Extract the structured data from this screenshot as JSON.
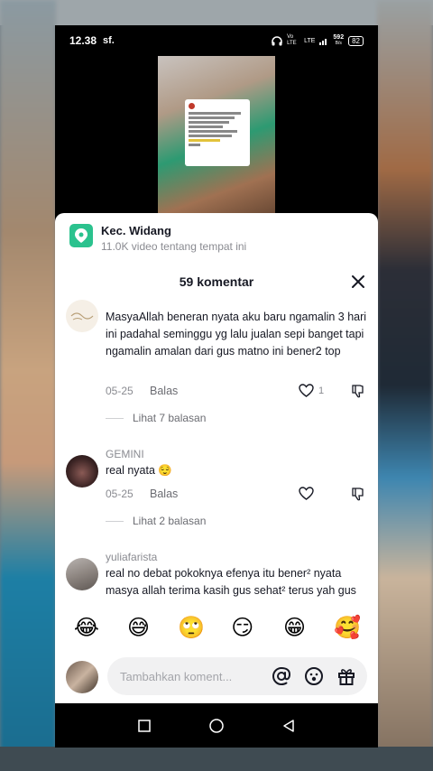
{
  "status_bar": {
    "time": "12.38",
    "carrier_icon": "sf.",
    "net_label": "Vo LTE",
    "lte": "LTE",
    "speed": "592",
    "speed_unit": "B/s",
    "battery": "82"
  },
  "location": {
    "title": "Kec. Widang",
    "subtitle": "11.0K video tentang tempat ini",
    "pin_color": "#2bc28e"
  },
  "comments_header": {
    "title": "59 komentar"
  },
  "comments": [
    {
      "username": "",
      "text": "MasyaAllah beneran nyata aku baru ngamalin 3 hari ini padahal seminggu yg lalu jualan sepi banget tapi ngamalin amalan dari gus matno ini bener2 top",
      "date": "05-25",
      "reply_label": "Balas",
      "likes": "1",
      "view_replies": "Lihat 7 balasan"
    },
    {
      "username": "GEMINI",
      "text": "real nyata 😌",
      "date": "05-25",
      "reply_label": "Balas",
      "likes": "",
      "view_replies": "Lihat 2 balasan"
    },
    {
      "username": "yuliafarista",
      "text": "real no debat pokoknya efenya itu bener² nyata masya allah terima kasih gus sehat² terus yah gus",
      "date": "",
      "reply_label": "",
      "likes": "",
      "view_replies": ""
    }
  ],
  "emojis": [
    "😂",
    "😅",
    "🙄",
    "😏",
    "😁",
    "🥰"
  ],
  "input": {
    "placeholder": "Tambahkan koment..."
  },
  "icons": {
    "location": "location-pin-icon",
    "close": "close-icon",
    "like": "heart-icon",
    "dislike": "thumbs-down-icon",
    "mention": "at-icon",
    "emoji": "emoji-icon",
    "gift": "gift-icon"
  }
}
